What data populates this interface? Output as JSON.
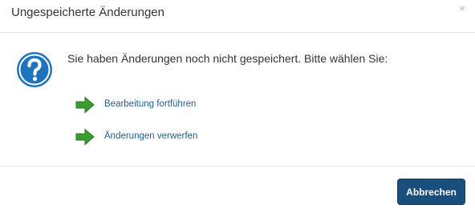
{
  "dialog": {
    "title": "Ungespeicherte Änderungen",
    "close_label": "×",
    "message": "Sie haben Änderungen noch nicht gespeichert. Bitte wählen Sie:",
    "actions": [
      {
        "label": "Bearbeitung fortführen",
        "icon": "arrow-right-icon"
      },
      {
        "label": "Änderungen verwerfen",
        "icon": "arrow-right-icon"
      }
    ],
    "cancel_label": "Abbrechen",
    "colors": {
      "accent": "#1a4e7d",
      "link": "#1f5f8b",
      "info_icon": "#1e73be",
      "arrow": "#3a9b2e"
    }
  }
}
